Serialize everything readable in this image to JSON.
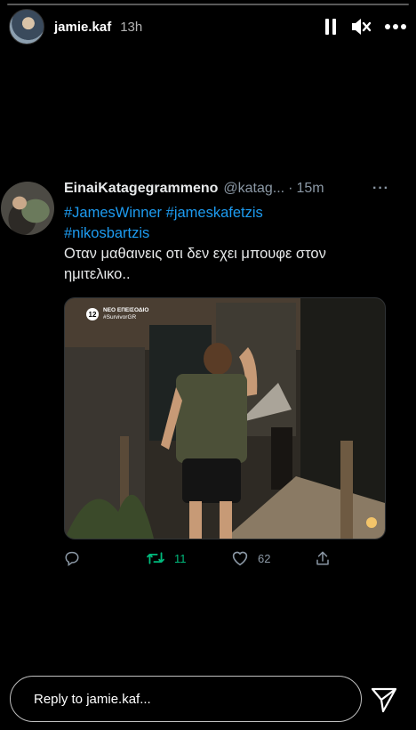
{
  "story": {
    "progress": 0.0,
    "username": "jamie.kaf",
    "time": "13h"
  },
  "tweet": {
    "display_name": "EinaiKatagegrammeno",
    "handle": "@katag...",
    "separator": "·",
    "age": "15m",
    "more": "···",
    "hashtags": [
      "#JamesWinner",
      "#jameskafetzis",
      "#nikosbartzis"
    ],
    "text": "Οταν μαθαινεις οτι δεν εχει μπουφε στον ημιτελικο..",
    "media": {
      "badge_number": "12",
      "badge_line1": "ΝΕΟ ΕΠΕΙΣΟΔΙΟ",
      "badge_line2": "#SurvivorGR"
    },
    "retweets": "11",
    "likes": "62"
  },
  "reply": {
    "placeholder": "Reply to jamie.kaf..."
  },
  "colors": {
    "hashtag": "#1d9bf0",
    "retweet": "#00ba7c",
    "muted": "#8b98a5"
  },
  "icons": [
    "pause-icon",
    "mute-icon",
    "more-icon",
    "reply-icon",
    "retweet-icon",
    "like-icon",
    "share-icon",
    "send-icon"
  ]
}
